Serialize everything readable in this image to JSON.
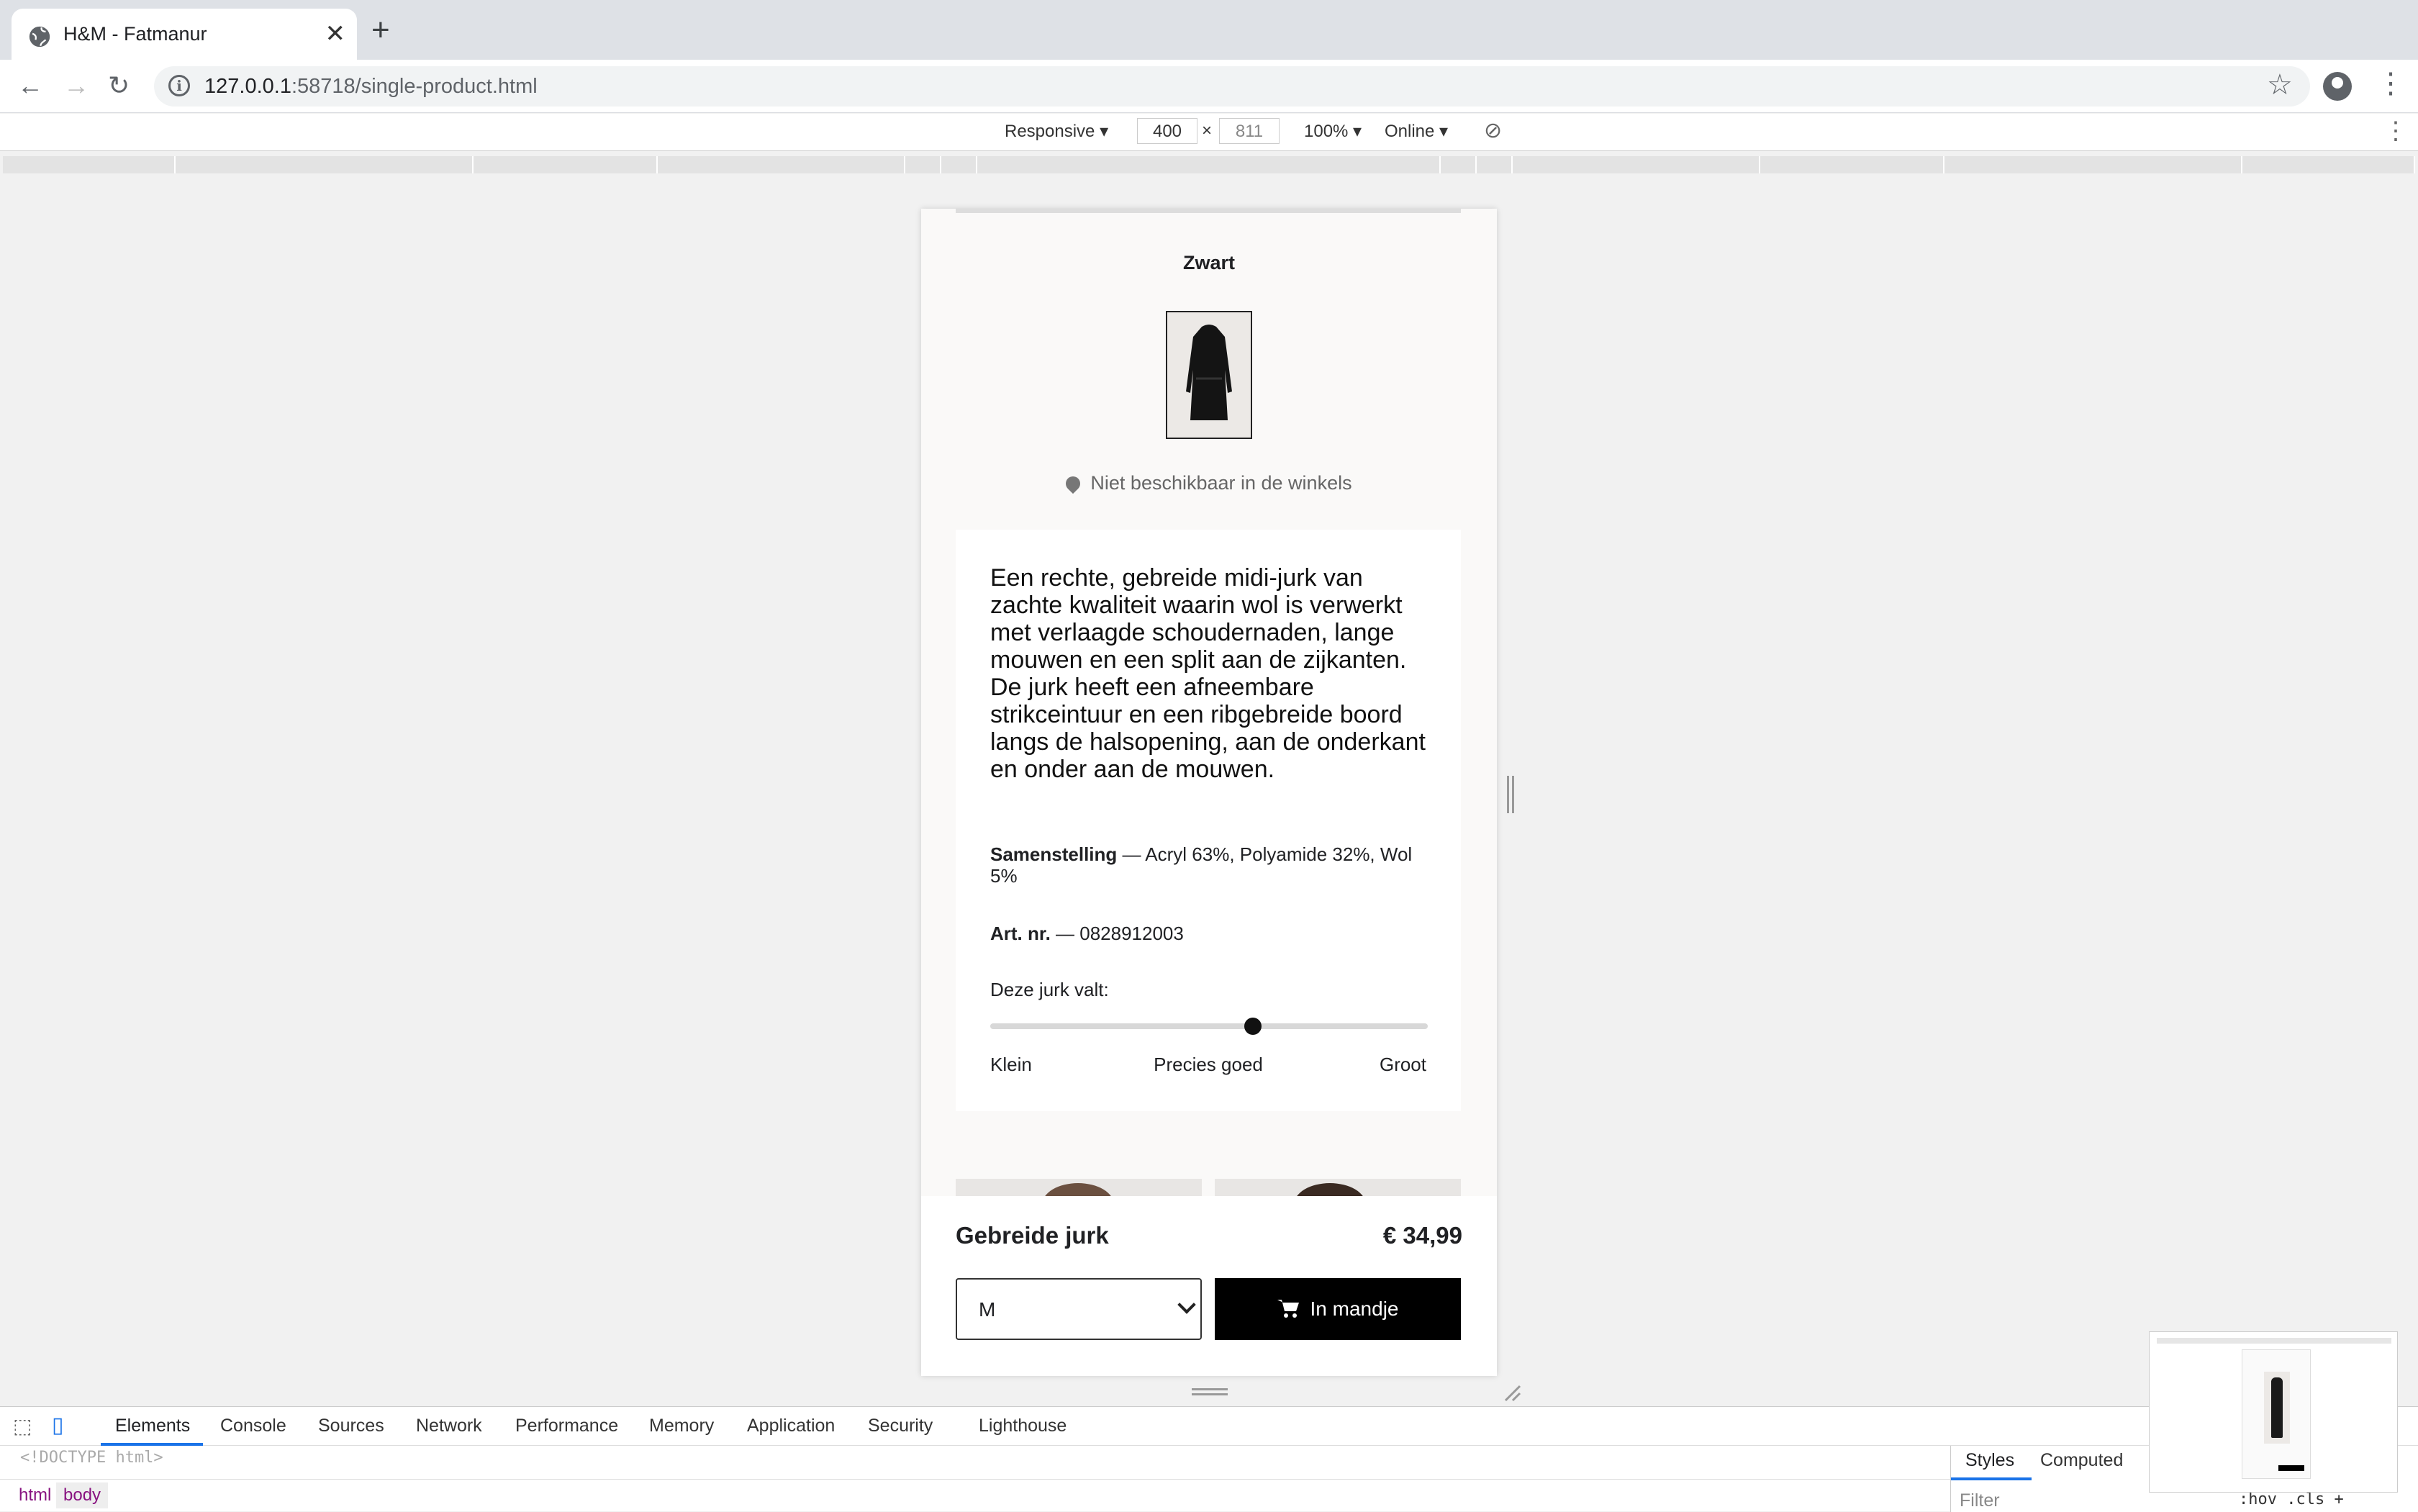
{
  "browser": {
    "tab_title": "H&M - Fatmanur",
    "url_host": "127.0.0.1",
    "url_path": ":58718/single-product.html"
  },
  "device_toolbar": {
    "mode": "Responsive ▾",
    "width": "400",
    "times": "×",
    "height": "811",
    "zoom": "100% ▾",
    "network": "Online ▾"
  },
  "product": {
    "color_name": "Zwart",
    "availability": "Niet beschikbaar in de winkels",
    "description": "Een rechte, gebreide midi-jurk van zachte kwaliteit waarin wol is verwerkt met verlaagde schoudernaden, lange mouwen en een split aan de zijkanten. De jurk heeft een afneembare strikceintuur en een ribgebreide boord langs de halsopening, aan de onderkant en onder aan de mouwen.",
    "composition_label": "Samenstelling",
    "composition_value": " — Acryl 63%, Polyamide 32%, Wol 5%",
    "artnr_label": "Art. nr.",
    "artnr_value": " — 0828912003",
    "fit_label": "Deze jurk valt:",
    "fit_small": "Klein",
    "fit_good": "Precies goed",
    "fit_big": "Groot",
    "fit_level": 0.6,
    "name": "Gebreide jurk",
    "price": "€ 34,99",
    "size": "M",
    "cart_label": "In mandje"
  },
  "devtools": {
    "tabs": [
      "Elements",
      "Console",
      "Sources",
      "Network",
      "Performance",
      "Memory",
      "Application",
      "Security",
      "Lighthouse"
    ],
    "active_tab": "Elements",
    "code_line": "<!DOCTYPE html>",
    "crumbs": [
      "html",
      "body"
    ],
    "side_tabs": [
      "Styles",
      "Computed"
    ],
    "filter_placeholder": "Filter",
    "side_tools": ":hov  .cls  +"
  },
  "colors": {
    "accent": "#1a73e8",
    "button_bg": "#000000",
    "page_bg": "#faf9f8"
  }
}
